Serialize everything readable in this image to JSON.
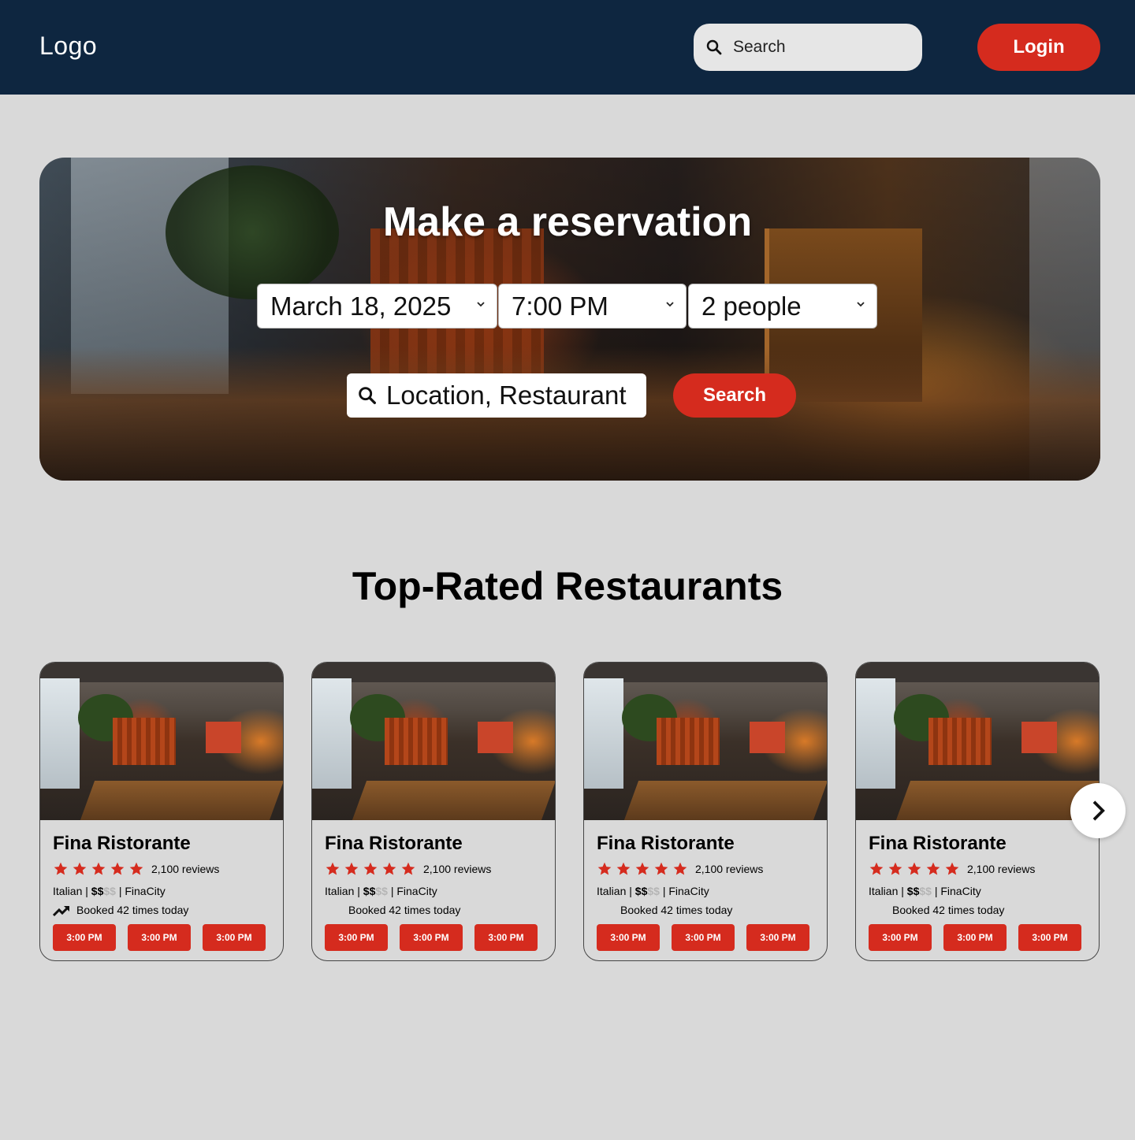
{
  "header": {
    "logo": "Logo",
    "search_placeholder": "Search",
    "login_label": "Login"
  },
  "hero": {
    "title": "Make a reservation",
    "date": "March 18, 2025",
    "time": "7:00 PM",
    "party": "2 people",
    "location_placeholder": "Location, Restaurant",
    "search_label": "Search"
  },
  "section": {
    "title": "Top-Rated Restaurants"
  },
  "cards": [
    {
      "name": "Fina Ristorante",
      "rating": 5,
      "reviews": "2,100 reviews",
      "cuisine": "Italian",
      "price_active": "$$",
      "price_inactive": "$$",
      "city": "FinaCity",
      "booked": "Booked 42 times today",
      "show_trend_icon": true,
      "slots": [
        "3:00 PM",
        "3:00 PM",
        "3:00 PM"
      ]
    },
    {
      "name": "Fina Ristorante",
      "rating": 5,
      "reviews": "2,100 reviews",
      "cuisine": "Italian",
      "price_active": "$$",
      "price_inactive": "$$",
      "city": "FinaCity",
      "booked": "Booked 42 times today",
      "show_trend_icon": false,
      "slots": [
        "3:00 PM",
        "3:00 PM",
        "3:00 PM"
      ]
    },
    {
      "name": "Fina Ristorante",
      "rating": 5,
      "reviews": "2,100 reviews",
      "cuisine": "Italian",
      "price_active": "$$",
      "price_inactive": "$$",
      "city": "FinaCity",
      "booked": "Booked 42 times today",
      "show_trend_icon": false,
      "slots": [
        "3:00 PM",
        "3:00 PM",
        "3:00 PM"
      ]
    },
    {
      "name": "Fina Ristorante",
      "rating": 5,
      "reviews": "2,100 reviews",
      "cuisine": "Italian",
      "price_active": "$$",
      "price_inactive": "$$",
      "city": "FinaCity",
      "booked": "Booked 42 times today",
      "show_trend_icon": false,
      "slots": [
        "3:00 PM",
        "3:00 PM",
        "3:00 PM"
      ]
    }
  ],
  "colors": {
    "header_bg": "#0e2640",
    "accent": "#d52b1e",
    "page_bg": "#d9d9d9"
  },
  "icons": {
    "search": "search-icon",
    "chevron": "chevron-down-icon",
    "star": "star-icon",
    "trend": "trending-up-icon",
    "next": "chevron-right-icon"
  }
}
